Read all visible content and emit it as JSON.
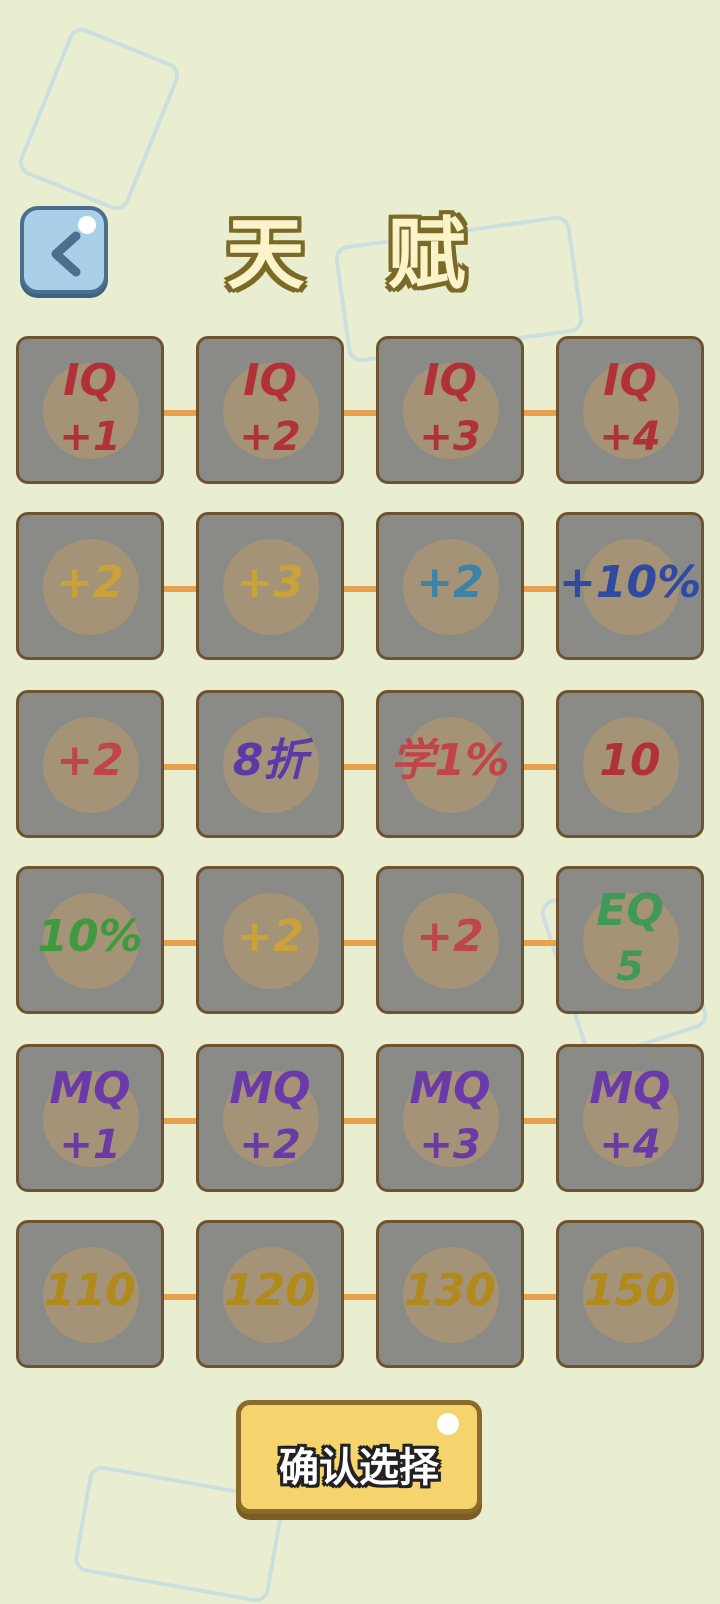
{
  "title": "天 赋",
  "back_label": "back",
  "confirm_label": "确认选择",
  "rows": [
    [
      {
        "label": "IQ",
        "sub": "+1",
        "color": "#b1313a",
        "icon": "lightbulb-icon"
      },
      {
        "label": "IQ",
        "sub": "+2",
        "color": "#b1313a",
        "icon": "lightbulb-icon"
      },
      {
        "label": "IQ",
        "sub": "+3",
        "color": "#b1313a",
        "icon": "lightbulb-icon"
      },
      {
        "label": "IQ",
        "sub": "+4",
        "color": "#b1313a",
        "icon": "lightbulb-icon"
      }
    ],
    [
      {
        "label": "+2",
        "sub": "",
        "color": "#c9a33a",
        "icon": "heart-icon"
      },
      {
        "label": "+3",
        "sub": "",
        "color": "#c9a33a",
        "icon": "heart-icon"
      },
      {
        "label": "+2",
        "sub": "",
        "color": "#3b83a8",
        "icon": "ruler-icon"
      },
      {
        "label": "+10%",
        "sub": "",
        "color": "#2f4aa0",
        "icon": "clock-icon"
      }
    ],
    [
      {
        "label": "+2",
        "sub": "",
        "color": "#c0454a",
        "icon": "couple-hearts-icon"
      },
      {
        "label": "8折",
        "sub": "",
        "color": "#5b3aa8",
        "icon": "shopping-bag-icon"
      },
      {
        "label": "学1%",
        "sub": "",
        "color": "#c0454a",
        "icon": "cloud-icon"
      },
      {
        "label": "10",
        "sub": "",
        "color": "#b1313a",
        "icon": "up-arrow-icon"
      }
    ],
    [
      {
        "label": "10%",
        "sub": "",
        "color": "#3f9a3f",
        "icon": "chest-icon"
      },
      {
        "label": "+2",
        "sub": "",
        "color": "#c9a33a",
        "icon": "hearts-icon"
      },
      {
        "label": "+2",
        "sub": "",
        "color": "#c0454a",
        "icon": "muscle-icon"
      },
      {
        "label": "EQ",
        "sub": "5",
        "color": "#3f9a5a",
        "icon": "up-arrow-icon"
      }
    ],
    [
      {
        "label": "MQ",
        "sub": "+1",
        "color": "#6a3aa8",
        "icon": "brain-icon"
      },
      {
        "label": "MQ",
        "sub": "+2",
        "color": "#6a3aa8",
        "icon": "brain-icon"
      },
      {
        "label": "MQ",
        "sub": "+3",
        "color": "#6a3aa8",
        "icon": "brain-icon"
      },
      {
        "label": "MQ",
        "sub": "+4",
        "color": "#6a3aa8",
        "icon": "brain-icon"
      }
    ],
    [
      {
        "label": "110",
        "sub": "",
        "color": "#b08a1a",
        "icon": "red-arrow-icon"
      },
      {
        "label": "120",
        "sub": "",
        "color": "#b08a1a",
        "icon": "red-arrow-icon"
      },
      {
        "label": "130",
        "sub": "",
        "color": "#b08a1a",
        "icon": "red-arrow-icon"
      },
      {
        "label": "150",
        "sub": "",
        "color": "#b08a1a",
        "icon": "red-arrow-icon"
      }
    ]
  ]
}
